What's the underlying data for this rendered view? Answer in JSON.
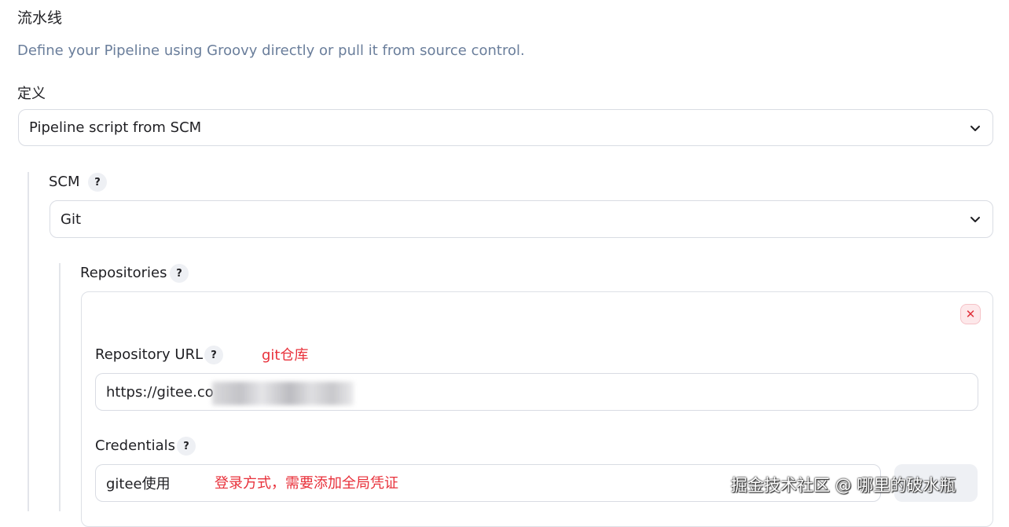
{
  "pipeline": {
    "section_title": "流水线",
    "description": "Define your Pipeline using Groovy directly or pull it from source control.",
    "definition_label": "定义",
    "definition_value": "Pipeline script from SCM"
  },
  "scm": {
    "label": "SCM",
    "help": "?",
    "value": "Git"
  },
  "repositories": {
    "label": "Repositories",
    "help": "?",
    "delete_label": "✕",
    "repository_url": {
      "label": "Repository URL",
      "help": "?",
      "value": "https://gitee.co",
      "annotation": "git仓库"
    },
    "credentials": {
      "label": "Credentials",
      "help": "?",
      "value": "gitee使用",
      "annotation": "登录方式，需要添加全局凭证"
    }
  },
  "watermark": "掘金技术社区 @ 哪里的破水瓶",
  "colors": {
    "annotation": "#e8303a",
    "description": "#6a7e9b",
    "border": "#d9dce3"
  }
}
